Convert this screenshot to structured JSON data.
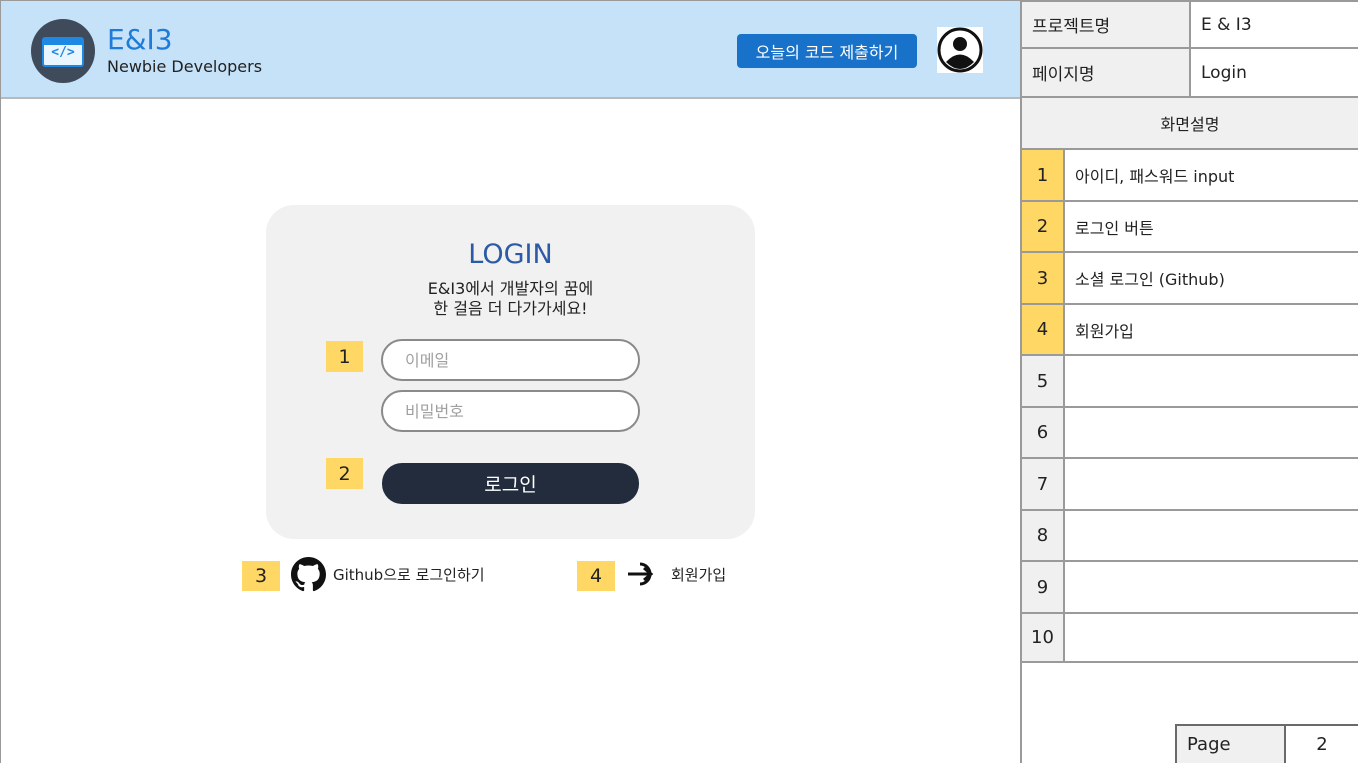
{
  "header": {
    "brand_name": "E&I3",
    "brand_sub": "Newbie Developers",
    "logo_icon": "code-window-icon",
    "submit_label": "오늘의 코드 제출하기",
    "avatar_icon": "user-avatar-icon",
    "colors": {
      "background": "#c5e2f8",
      "button": "#1872c9"
    }
  },
  "login": {
    "title": "LOGIN",
    "desc_line1": "E&I3에서 개발자의 꿈에",
    "desc_line2": "한 걸음 더 다가가세요!",
    "email_placeholder": "이메일",
    "password_placeholder": "비밀번호",
    "login_label": "로그인",
    "github_label": "Github으로 로그인하기",
    "github_icon": "github-icon",
    "signup_label": "회원가입",
    "signup_icon": "sign-in-arrow-icon"
  },
  "markers": [
    "1",
    "2",
    "3",
    "4"
  ],
  "spec": {
    "project_label": "프로젝트명",
    "project_value": "E & I3",
    "page_name_label": "페이지명",
    "page_name_value": "Login",
    "desc_header": "화면설명",
    "rows": [
      {
        "num": "1",
        "desc": "아이디, 패스워드 input"
      },
      {
        "num": "2",
        "desc": "로그인 버튼"
      },
      {
        "num": "3",
        "desc": "소셜 로그인 (Github)"
      },
      {
        "num": "4",
        "desc": "회원가입"
      },
      {
        "num": "5",
        "desc": ""
      },
      {
        "num": "6",
        "desc": ""
      },
      {
        "num": "7",
        "desc": ""
      },
      {
        "num": "8",
        "desc": ""
      },
      {
        "num": "9",
        "desc": ""
      },
      {
        "num": "10",
        "desc": ""
      }
    ],
    "page_label": "Page",
    "page_value": "2",
    "highlight_color": "#ffd764"
  }
}
